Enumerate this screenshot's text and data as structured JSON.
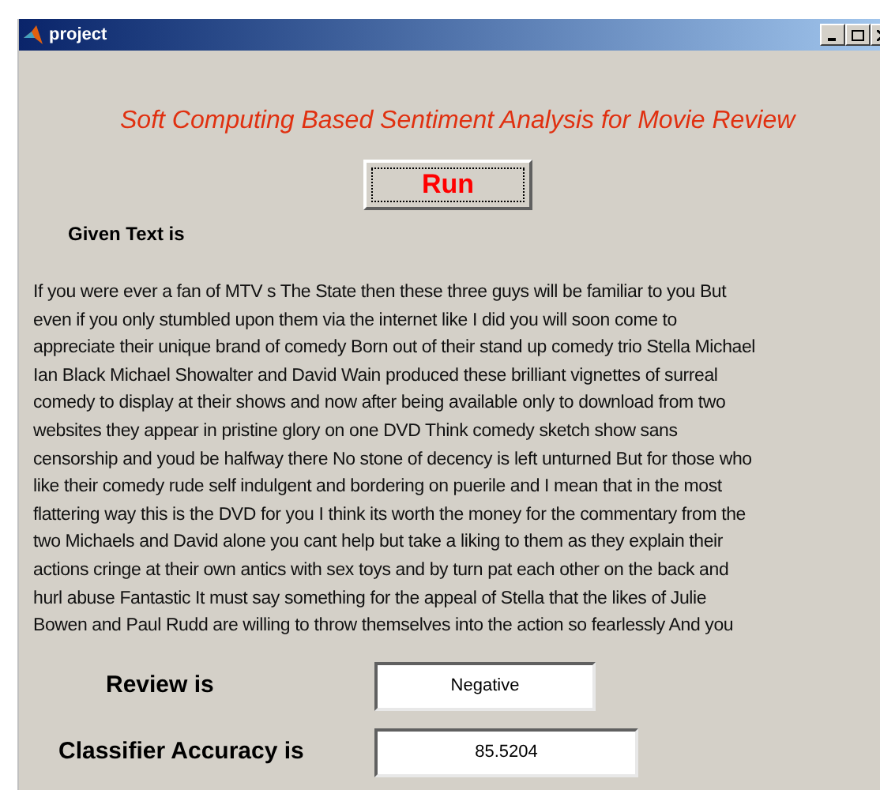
{
  "window": {
    "title": "project"
  },
  "heading": "Soft Computing Based Sentiment Analysis for Movie Review",
  "run_button": "Run",
  "given_text_label": "Given Text is",
  "given_text_lines": [
    "If you were ever a fan of MTV s The State then these three guys will be familiar to you But",
    "even if you only stumbled upon them via the internet like I did you will soon come to",
    "appreciate their unique brand of comedy Born out of their stand up comedy trio Stella Michael",
    "Ian Black Michael Showalter and David Wain produced these brilliant vignettes of surreal",
    "comedy to display at their shows and now after being available only to download from two",
    "websites they appear in pristine glory on one DVD Think comedy sketch show sans",
    "censorship and youd be halfway there No stone of decency is left unturned But for those who",
    "like their comedy rude self indulgent and bordering on puerile and I mean that in the most",
    "flattering way this is the DVD for you I think its worth the money for the commentary from the",
    "two Michaels and David alone you cant help but take a liking to them as they explain their",
    "actions cringe at their own antics with sex toys and by turn pat each other on the back and",
    "hurl abuse Fantastic It must say something for the appeal of Stella that the likes of Julie",
    "Bowen and Paul Rudd are willing to throw themselves into the action so fearlessly And you"
  ],
  "results": [
    {
      "label": "Review is",
      "value": "Negative"
    },
    {
      "label": "Classifier Accuracy is",
      "value": "85.5204"
    }
  ]
}
